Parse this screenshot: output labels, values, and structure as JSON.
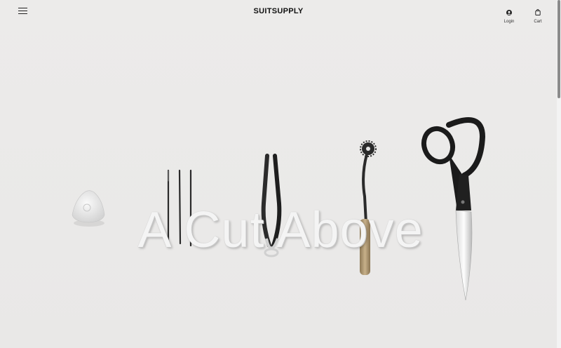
{
  "header": {
    "brand": "SUITSUPPLY",
    "login_label": "Login",
    "cart_label": "Cart"
  },
  "hero": {
    "headline": "A Cut Above"
  },
  "icons": {
    "menu": "hamburger-menu-icon",
    "login": "user-icon",
    "cart": "shopping-bag-icon"
  },
  "colors": {
    "background": "#ebeae9",
    "text": "#111111"
  }
}
